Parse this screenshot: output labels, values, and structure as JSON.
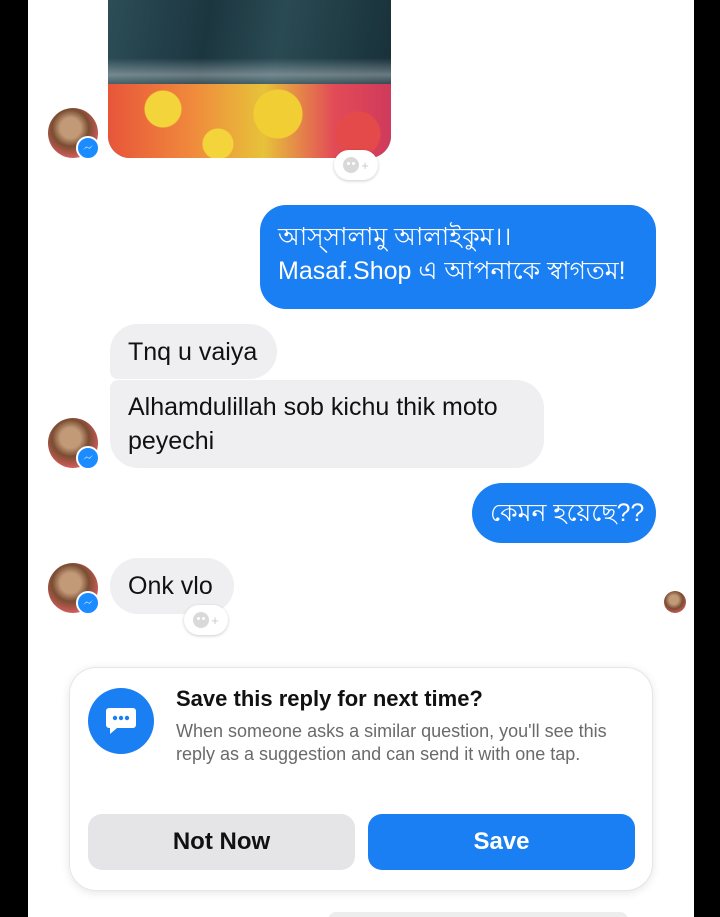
{
  "conversation": {
    "messages": [
      {
        "sender": "shop",
        "lines": [
          "আস্সালামু আলাইকুম।।",
          "Masaf.Shop এ আপনাকে স্বাগতম!"
        ]
      },
      {
        "sender": "customer",
        "text": "Tnq u vaiya"
      },
      {
        "sender": "customer",
        "text": "Alhamdulillah sob kichu thik moto peyechi"
      },
      {
        "sender": "shop",
        "text": "কেমন হয়েছে??"
      },
      {
        "sender": "customer",
        "text": "Onk vlo"
      }
    ]
  },
  "save_reply_prompt": {
    "title": "Save this reply for next time?",
    "description": "When someone asks a similar question, you'll see this reply as a suggestion and can send it with one tap.",
    "not_now_label": "Not Now",
    "save_label": "Save"
  },
  "colors": {
    "outgoing_bubble": "#1a7ff2",
    "incoming_bubble": "#efeff2",
    "messenger_badge": "#1a8cff"
  },
  "icons": {
    "reaction": "add-reaction-icon",
    "badge": "messenger-badge-icon",
    "prompt": "chat-bubble-icon"
  }
}
